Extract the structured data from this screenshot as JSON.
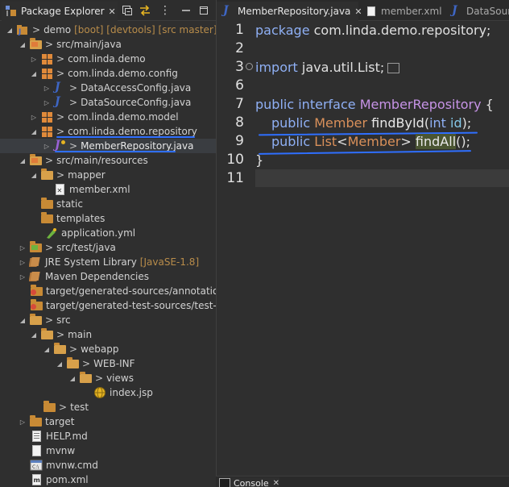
{
  "explorer": {
    "tab_label": "Package Explorer",
    "close_glyph": "✕"
  },
  "tree": [
    {
      "label": "demo",
      "deco": "[boot] [devtools] [src master]",
      "icon": "project-icon"
    },
    {
      "label": "src/main/java",
      "icon": "source-folder-icon"
    },
    {
      "label": "com.linda.demo",
      "icon": "package-icon"
    },
    {
      "label": "com.linda.demo.config",
      "icon": "package-icon"
    },
    {
      "label": "DataAccessConfig.java",
      "icon": "java-file-icon"
    },
    {
      "label": "DataSourceConfig.java",
      "icon": "java-file-icon"
    },
    {
      "label": "com.linda.demo.model",
      "icon": "package-icon"
    },
    {
      "label": "com.linda.demo.repository",
      "icon": "package-icon"
    },
    {
      "label": "MemberRepository.java",
      "icon": "java-interface-icon"
    },
    {
      "label": "src/main/resources",
      "icon": "source-folder-icon"
    },
    {
      "label": "mapper",
      "icon": "folder-icon"
    },
    {
      "label": "member.xml",
      "icon": "xml-file-icon"
    },
    {
      "label": "static",
      "icon": "folder-icon"
    },
    {
      "label": "templates",
      "icon": "folder-icon"
    },
    {
      "label": "application.yml",
      "icon": "yml-file-icon"
    },
    {
      "label": "src/test/java",
      "icon": "source-folder-icon"
    },
    {
      "label": "JRE System Library",
      "deco": "[JavaSE-1.8]",
      "icon": "library-icon"
    },
    {
      "label": "Maven Dependencies",
      "icon": "library-icon"
    },
    {
      "label": "target/generated-sources/annotations",
      "icon": "generated-folder-icon"
    },
    {
      "label": "target/generated-test-sources/test-ann",
      "icon": "generated-folder-icon"
    },
    {
      "label": "src",
      "icon": "folder-icon"
    },
    {
      "label": "main",
      "icon": "folder-icon"
    },
    {
      "label": "webapp",
      "icon": "folder-icon"
    },
    {
      "label": "WEB-INF",
      "icon": "folder-icon"
    },
    {
      "label": "views",
      "icon": "folder-icon"
    },
    {
      "label": "index.jsp",
      "icon": "jsp-file-icon"
    },
    {
      "label": "test",
      "icon": "folder-icon"
    },
    {
      "label": "target",
      "icon": "folder-icon"
    },
    {
      "label": "HELP.md",
      "icon": "md-file-icon"
    },
    {
      "label": "mvnw",
      "icon": "file-icon"
    },
    {
      "label": "mvnw.cmd",
      "icon": "cmd-file-icon"
    },
    {
      "label": "pom.xml",
      "icon": "xml-file-icon"
    }
  ],
  "editor": {
    "tabs": [
      {
        "label": "MemberRepository.java",
        "icon": "java-file-icon"
      },
      {
        "label": "member.xml",
        "icon": "xml-file-icon"
      },
      {
        "label": "DataSour",
        "icon": "java-file-icon"
      }
    ],
    "line_numbers": [
      "1",
      "2",
      "3",
      "6",
      "7",
      "8",
      "9",
      "10",
      "11"
    ],
    "code": {
      "l1_kw": "package",
      "l1_rest": " com.linda.demo.repository;",
      "l3_kw": "import",
      "l3_rest": " java.util.List;",
      "l7_kw1": "public",
      "l7_kw2": "interface",
      "l7_name": "MemberRepository",
      "l7_rest": " {",
      "l8_kw": "public",
      "l8_type": "Member",
      "l8_method": "findById",
      "l8_open": "(",
      "l8_ptype": "int",
      "l8_param": "id",
      "l8_close": ");",
      "l9_kw": "public",
      "l9_type1": "List",
      "l9_lt": "<",
      "l9_type2": "Member",
      "l9_gt": ">",
      "l9_method": "findAll",
      "l9_close": "();",
      "l10": "}"
    }
  },
  "bottom": {
    "console_label": "Console"
  },
  "colors": {
    "accent_underline": "#2f6fff",
    "keyword": "#8fb0f5",
    "type": "#d9905a"
  }
}
